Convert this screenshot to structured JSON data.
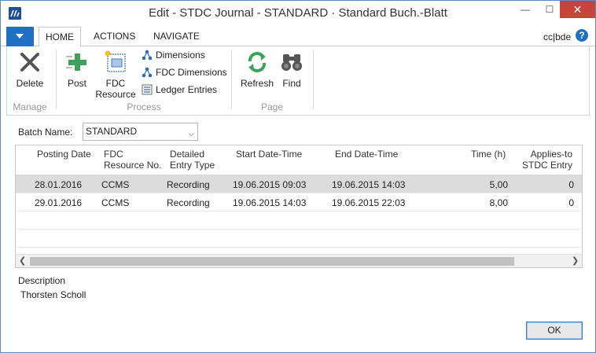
{
  "window": {
    "title": "Edit - STDC Journal - STANDARD · Standard Buch.-Blatt",
    "min_glyph": "—",
    "max_glyph": "☐",
    "close_glyph": "✕"
  },
  "ribbon_tabs": [
    {
      "label": "HOME"
    },
    {
      "label": "ACTIONS"
    },
    {
      "label": "NAVIGATE"
    }
  ],
  "user": "cc|bde",
  "help_glyph": "?",
  "ribbon": {
    "manage": {
      "label": "Manage",
      "delete_label": "Delete"
    },
    "process": {
      "label": "Process",
      "post_label": "Post",
      "fdc_resource_label_1": "FDC",
      "fdc_resource_label_2": "Resource",
      "dimensions_label": "Dimensions",
      "fdc_dimensions_label": "FDC Dimensions",
      "ledger_entries_label": "Ledger Entries"
    },
    "page": {
      "label": "Page",
      "refresh_label": "Refresh",
      "find_label": "Find"
    }
  },
  "batch": {
    "label": "Batch Name:",
    "value": "STANDARD"
  },
  "grid": {
    "columns": {
      "posting_date": "Posting Date",
      "fdc_resource_1": "FDC",
      "fdc_resource_2": "Resource No.",
      "detailed_1": "Detailed",
      "detailed_2": "Entry Type",
      "start": "Start Date-Time",
      "end": "End Date-Time",
      "time": "Time (h)",
      "applies_1": "Applies-to",
      "applies_2": "STDC Entry"
    },
    "rows": [
      {
        "posting_date": "28.01.2016",
        "resource": "CCMS",
        "entry_type": "Recording",
        "start": "19.06.2015 09:03",
        "end": "19.06.2015 14:03",
        "time": "5,00",
        "applies": "0"
      },
      {
        "posting_date": "29.01.2016",
        "resource": "CCMS",
        "entry_type": "Recording",
        "start": "19.06.2015 14:03",
        "end": "19.06.2015 22:03",
        "time": "8,00",
        "applies": "0"
      }
    ]
  },
  "description": {
    "label": "Description",
    "value": "Thorsten Scholl"
  },
  "ok_label": "OK",
  "colors": {
    "accent": "#1f6fc5",
    "close": "#c7443a",
    "selected_row": "#dcdcdc",
    "green": "#3da35a"
  }
}
